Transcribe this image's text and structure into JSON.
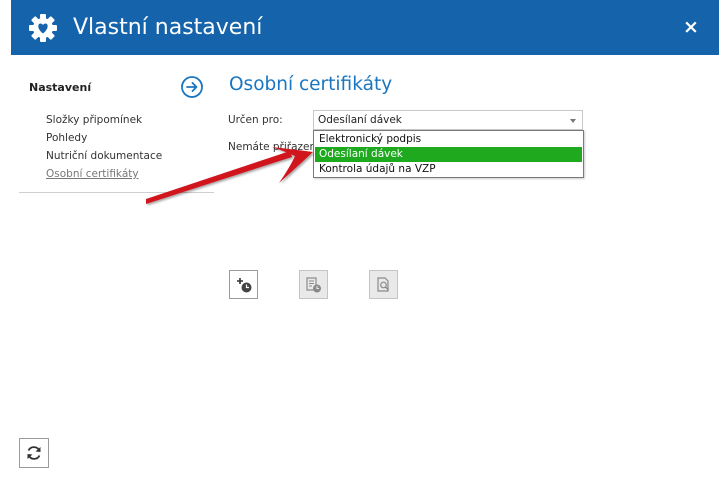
{
  "window": {
    "title": "Vlastní nastavení",
    "icon": "gear-heart-icon",
    "close_glyph": "×",
    "accent_color": "#1463ab"
  },
  "sidebar": {
    "heading": "Nastavení",
    "items": [
      {
        "label": "Složky připomínek",
        "active": false
      },
      {
        "label": "Pohledy",
        "active": false
      },
      {
        "label": "Nutriční dokumentace",
        "active": false
      },
      {
        "label": "Osobní certifikáty",
        "active": true
      }
    ]
  },
  "main": {
    "title": "Osobní certifikáty",
    "title_color": "#1a76c0",
    "field_label": "Určen pro:",
    "select": {
      "value": "Odesílaní dávek",
      "options": [
        "Elektronický podpis",
        "Odesílaní dávek",
        "Kontrola údajů na VZP"
      ],
      "selected_index": 1,
      "highlight_color": "#1ea91e"
    },
    "info_text": "Nemáte přiřazený"
  },
  "toolbar": {
    "buttons": [
      {
        "name": "add-certificate-button",
        "icon": "add-clock-icon",
        "enabled": true
      },
      {
        "name": "certificate-detail-button",
        "icon": "document-clock-icon",
        "enabled": false
      },
      {
        "name": "preview-certificate-button",
        "icon": "magnifier-document-icon",
        "enabled": false
      }
    ]
  },
  "footer": {
    "refresh_icon": "refresh-icon"
  },
  "annotation": {
    "arrow_color": "#d0191d"
  }
}
